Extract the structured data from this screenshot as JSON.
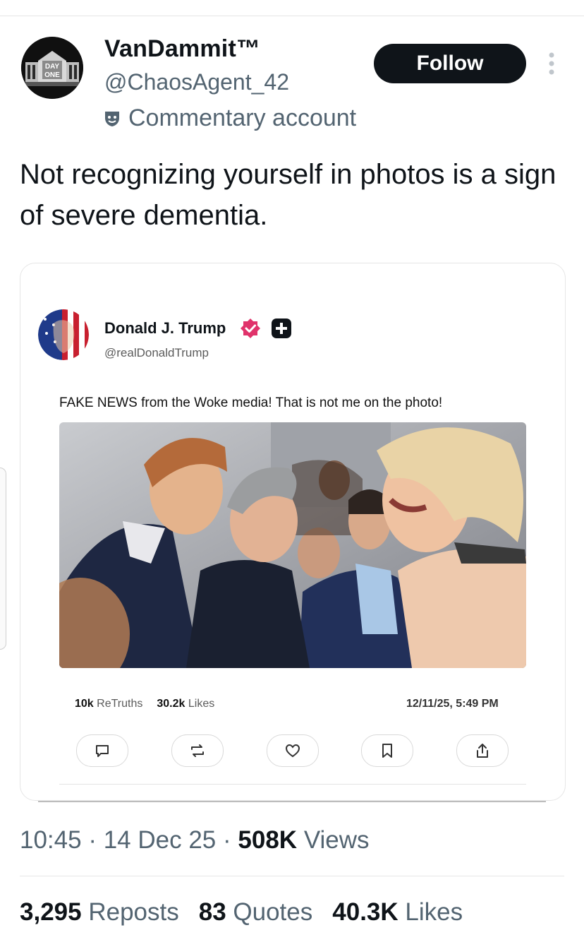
{
  "post": {
    "author": {
      "display_name": "VanDammit™",
      "handle": "@ChaosAgent_42",
      "label": "Commentary account",
      "avatar_text_1": "DAY",
      "avatar_text_2": "ONE"
    },
    "follow_label": "Follow",
    "text": "Not recognizing yourself in photos is a sign of severe dementia."
  },
  "embedded": {
    "author_name": "Donald J. Trump",
    "author_handle": "@realDonaldTrump",
    "text": "FAKE NEWS from the Woke media! That is not me on the photo!",
    "retruths_value": "10k",
    "retruths_label": "ReTruths",
    "likes_value": "30.2k",
    "likes_label": "Likes",
    "timestamp": "12/11/25, 5:49 PM",
    "actions": [
      "reply-icon",
      "retruth-icon",
      "like-icon",
      "bookmark-icon",
      "share-icon"
    ]
  },
  "meta": {
    "time": "10:45",
    "sep": "·",
    "date": "14 Dec 25",
    "views_value": "508K",
    "views_label": "Views"
  },
  "stats": {
    "reposts_value": "3,295",
    "reposts_label": "Reposts",
    "quotes_value": "83",
    "quotes_label": "Quotes",
    "likes_value": "40.3K",
    "likes_label": "Likes"
  },
  "colors": {
    "text": "#0f1419",
    "secondary": "#536471",
    "follow_bg": "#0f1419",
    "verified_badge": "#e0336b"
  }
}
